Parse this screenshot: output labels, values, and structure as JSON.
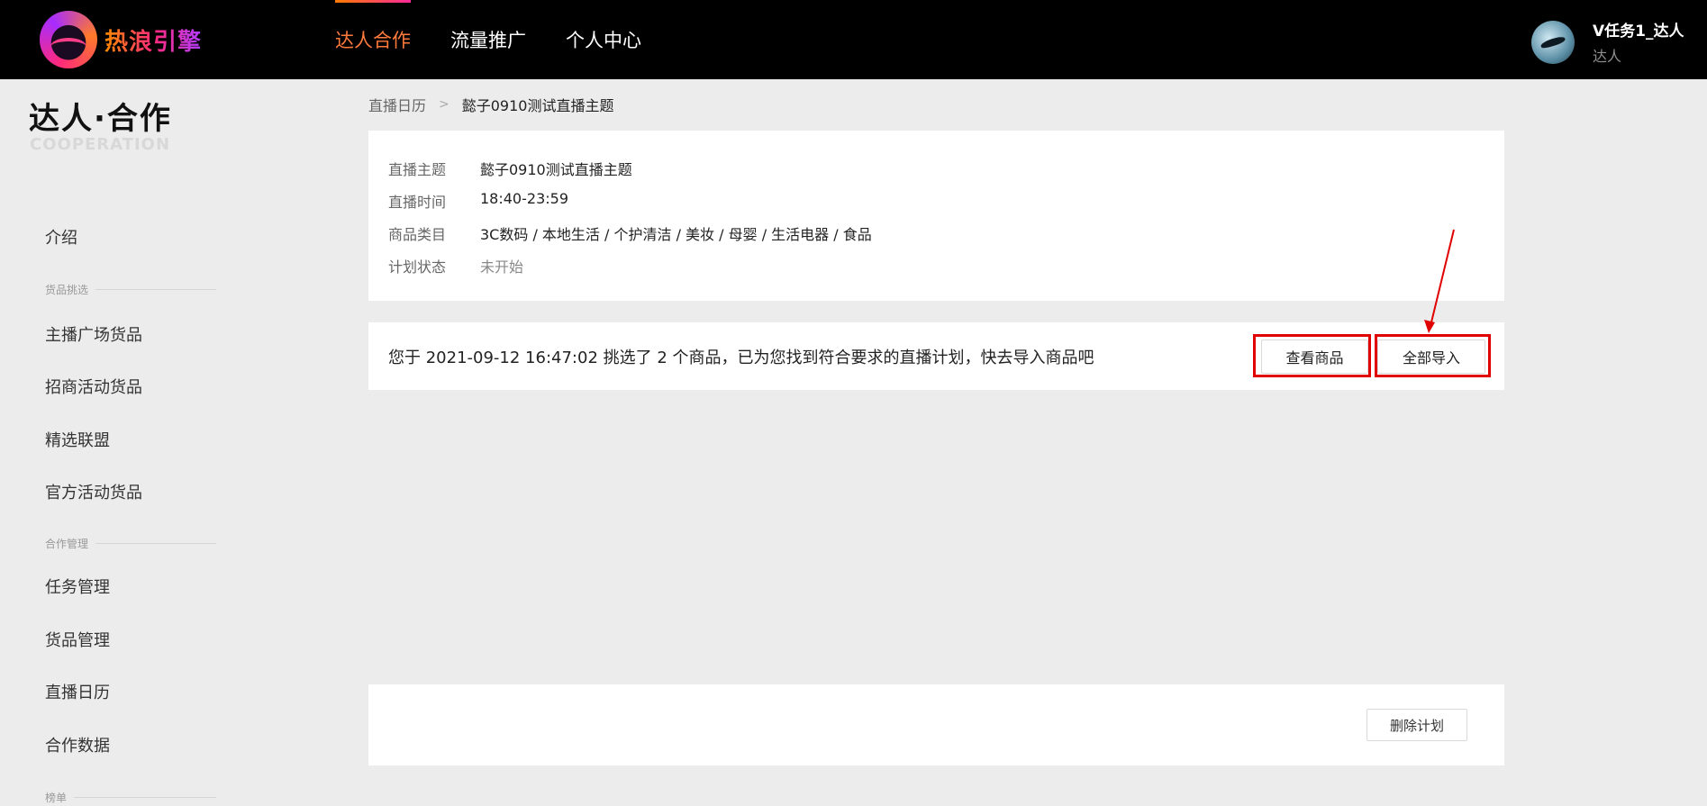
{
  "header": {
    "logo_text": "热浪引擎",
    "nav": [
      {
        "label": "达人合作",
        "active": true
      },
      {
        "label": "流量推广",
        "active": false
      },
      {
        "label": "个人中心",
        "active": false
      }
    ],
    "user": {
      "name": "V任务1_达人",
      "role": "达人"
    }
  },
  "sidebar": {
    "brand_cn": "达人·合作",
    "brand_en": "COOPERATION",
    "intro": "介绍",
    "group_products": "货品挑选",
    "products": [
      "主播广场货品",
      "招商活动货品",
      "精选联盟",
      "官方活动货品"
    ],
    "group_coop": "合作管理",
    "coop": [
      "任务管理",
      "货品管理",
      "直播日历",
      "合作数据"
    ],
    "group_rank": "榜单"
  },
  "breadcrumb": {
    "parent": "直播日历",
    "current": "懿子0910测试直播主题"
  },
  "plan_info": {
    "rows": [
      {
        "label": "直播主题",
        "value": "懿子0910测试直播主题"
      },
      {
        "label": "直播时间",
        "value": "18:40-23:59"
      },
      {
        "label": "商品类目",
        "value": "3C数码 / 本地生活 / 个护清洁 / 美妆 / 母婴 / 生活电器 / 食品"
      },
      {
        "label": "计划状态",
        "value": "未开始"
      }
    ]
  },
  "notice": {
    "text": "您于 2021-09-12 16:47:02 挑选了 2 个商品，已为您找到符合要求的直播计划，快去导入商品吧",
    "view_button": "查看商品",
    "import_button": "全部导入"
  },
  "footer": {
    "delete_button": "删除计划"
  },
  "colors": {
    "accent": "#ff7a3c",
    "highlight": "#e00000",
    "page_bg": "#ececec"
  }
}
